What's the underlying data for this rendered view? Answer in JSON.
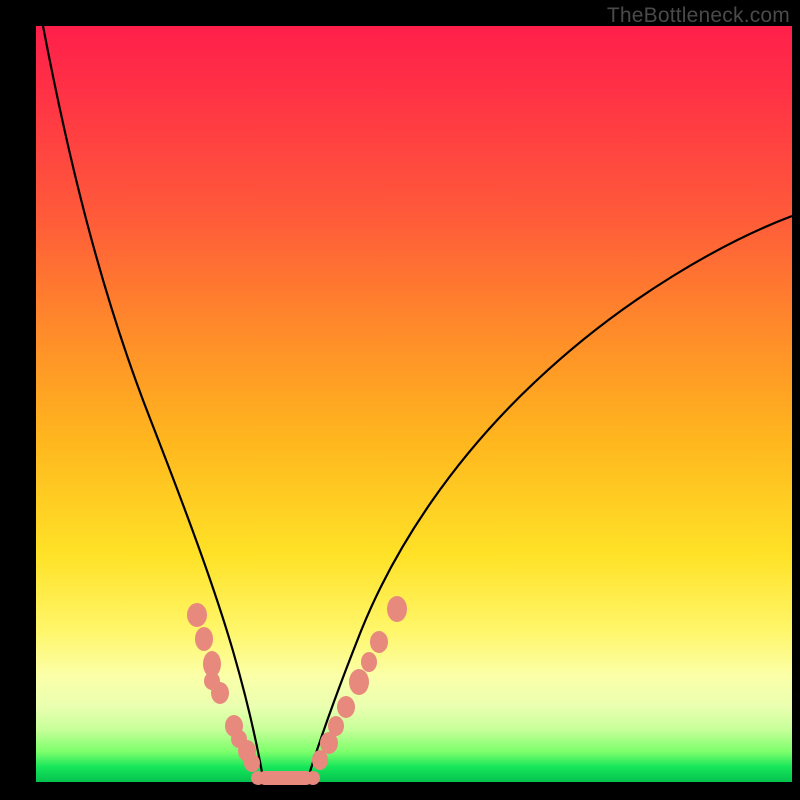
{
  "watermark": "TheBottleneck.com",
  "colors": {
    "marker": "#e8897e",
    "curve": "#000000"
  },
  "chart_data": {
    "type": "line",
    "title": "",
    "xlabel": "",
    "ylabel": "",
    "xlim": [
      0,
      100
    ],
    "ylim": [
      0,
      100
    ],
    "grid": false,
    "series": [
      {
        "name": "left-branch",
        "x": [
          1,
          5,
          10,
          15,
          18,
          21,
          23,
          25,
          26.5,
          28,
          29,
          30
        ],
        "y": [
          100,
          80,
          58,
          40,
          30,
          21,
          15,
          10,
          6.5,
          3.5,
          1.5,
          0
        ]
      },
      {
        "name": "right-branch",
        "x": [
          36,
          38,
          40,
          43,
          47,
          55,
          65,
          80,
          100
        ],
        "y": [
          0,
          3,
          7,
          13,
          22,
          36,
          49,
          63,
          75
        ]
      },
      {
        "name": "floor",
        "x": [
          30,
          36
        ],
        "y": [
          0,
          0
        ]
      }
    ],
    "markers": {
      "left": [
        {
          "x": 21.3,
          "y": 22.0
        },
        {
          "x": 22.2,
          "y": 18.8
        },
        {
          "x": 23.3,
          "y": 15.5
        },
        {
          "x": 23.3,
          "y": 13.2
        },
        {
          "x": 24.3,
          "y": 11.6
        },
        {
          "x": 26.2,
          "y": 7.3
        },
        {
          "x": 26.8,
          "y": 5.6
        },
        {
          "x": 27.9,
          "y": 4.0
        },
        {
          "x": 28.5,
          "y": 2.4
        }
      ],
      "floor": [
        {
          "x": 30.0,
          "y": 0.3
        },
        {
          "x": 31.6,
          "y": 0.3
        },
        {
          "x": 33.0,
          "y": 0.3
        },
        {
          "x": 34.3,
          "y": 0.3
        },
        {
          "x": 35.6,
          "y": 0.3
        }
      ],
      "right": [
        {
          "x": 37.6,
          "y": 2.8
        },
        {
          "x": 38.7,
          "y": 5.0
        },
        {
          "x": 39.7,
          "y": 7.3
        },
        {
          "x": 41.0,
          "y": 9.8
        },
        {
          "x": 42.7,
          "y": 13.2
        },
        {
          "x": 44.0,
          "y": 15.8
        },
        {
          "x": 45.4,
          "y": 18.4
        },
        {
          "x": 47.8,
          "y": 22.8
        }
      ]
    }
  }
}
